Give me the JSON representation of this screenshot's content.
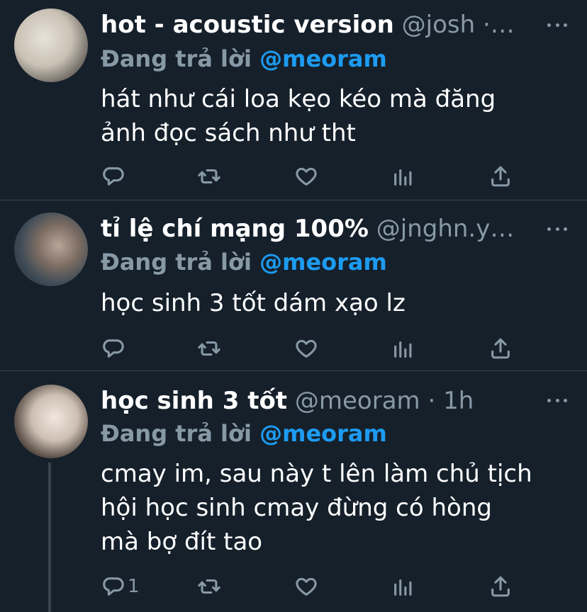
{
  "tweets": [
    {
      "name": "hot - acoustic version",
      "handle": "@josh ·…",
      "reply_prefix": "Đang trả lời",
      "reply_mention": "@meoram",
      "text_lines": [
        "hát như cái loa kẹo kéo mà đăng",
        "ảnh đọc sách như tht"
      ],
      "reply_count": ""
    },
    {
      "name": "tỉ lệ chí mạng 100%",
      "handle": "@jnghn.y…",
      "reply_prefix": "Đang trả lời",
      "reply_mention": "@meoram",
      "text_lines": [
        "học sinh 3 tốt dám xạo lz"
      ],
      "reply_count": ""
    },
    {
      "name": "học sinh 3 tốt",
      "handle": "@meoram · 1h",
      "reply_prefix": "Đang trả lời",
      "reply_mention": "@meoram",
      "text_lines": [
        "cmay im, sau này t lên làm chủ tịch",
        "hội học sinh cmay đừng có hòng",
        "mà bợ đít tao"
      ],
      "reply_count": "1"
    }
  ],
  "icons": [
    "reply-icon",
    "retweet-icon",
    "like-icon",
    "stats-icon",
    "share-icon",
    "more-icon"
  ],
  "colors": {
    "background": "#15202b",
    "divider": "#38444d",
    "secondary_text": "#8899a6",
    "mention": "#1d9bf0"
  }
}
